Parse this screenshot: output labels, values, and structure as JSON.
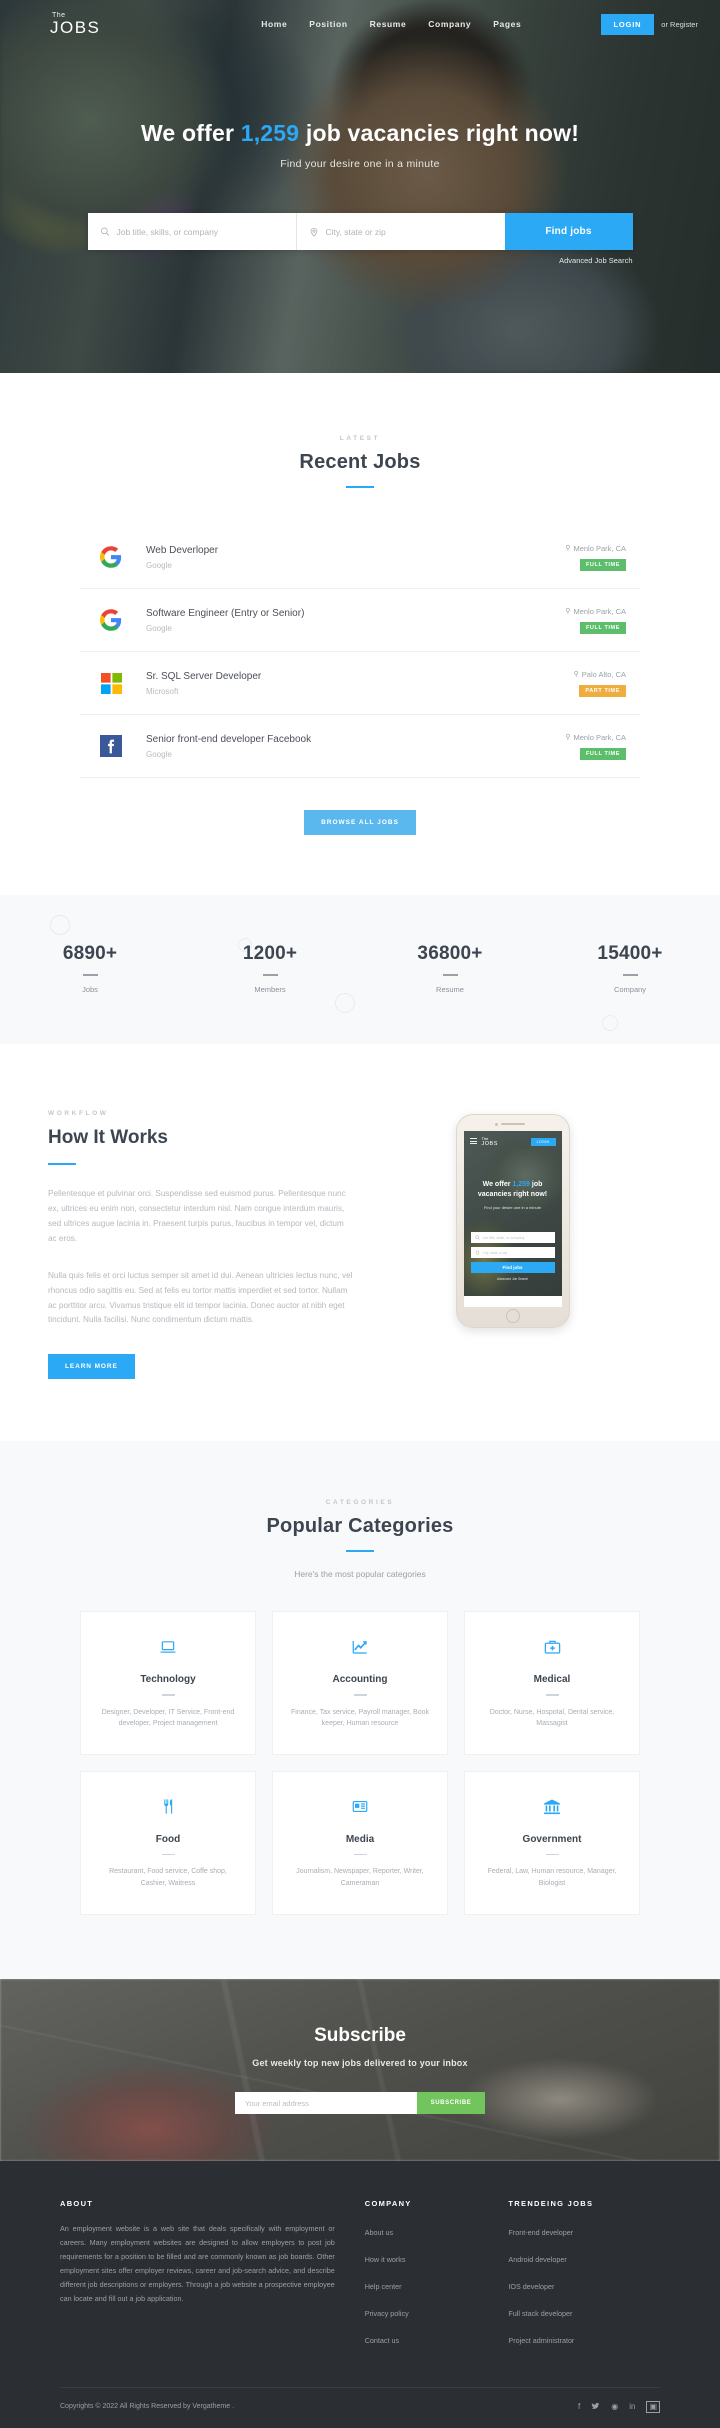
{
  "header": {
    "brand_the": "The",
    "brand_name": "JOBS",
    "nav": [
      {
        "label": "Home"
      },
      {
        "label": "Position"
      },
      {
        "label": "Resume"
      },
      {
        "label": "Company"
      },
      {
        "label": "Pages"
      }
    ],
    "login_label": "LOGIN",
    "or_register": "or Register"
  },
  "hero": {
    "title_pre": "We offer ",
    "title_count": "1,259",
    "title_post": " job vacancies right now!",
    "subtitle": "Find your desire one in a minute",
    "keyword_placeholder": "Job title, skills, or company",
    "location_placeholder": "City, state or zip",
    "keyword_value": "",
    "location_value": "",
    "find_jobs_label": "Find jobs",
    "advanced_search": "Advanced Job Search"
  },
  "recent": {
    "eyebrow": "LATEST",
    "title": "Recent Jobs",
    "jobs": [
      {
        "title": "Web Deverloper",
        "company": "Google",
        "logo": "google-logo",
        "location": "Menlo Park, CA",
        "type": "FULL TIME",
        "type_class": "full"
      },
      {
        "title": "Software Engineer (Entry or Senior)",
        "company": "Google",
        "logo": "google-logo",
        "location": "Menlo Park, CA",
        "type": "FULL TIME",
        "type_class": "full"
      },
      {
        "title": "Sr. SQL Server Developer",
        "company": "Microsoft",
        "logo": "microsoft-logo",
        "location": "Palo Alto, CA",
        "type": "PART TIME",
        "type_class": "part"
      },
      {
        "title": "Senior front-end developer Facebook",
        "company": "Google",
        "logo": "facebook-logo",
        "location": "Menlo Park, CA",
        "type": "FULL TIME",
        "type_class": "full"
      }
    ],
    "browse_label": "BROWSE ALL JOBS"
  },
  "counters": [
    {
      "value": "6890+",
      "label": "Jobs"
    },
    {
      "value": "1200+",
      "label": "Members"
    },
    {
      "value": "36800+",
      "label": "Resume"
    },
    {
      "value": "15400+",
      "label": "Company"
    }
  ],
  "howitworks": {
    "eyebrow": "WORKFLOW",
    "title": "How It Works",
    "paragraph1": "Pellentesque et pulvinar orci. Suspendisse sed euismod purus. Pellentesque nunc ex, ultrices eu enim non, consectetur interdum nisl. Nam congue interdum mauris, sed ultrices augue lacinia in. Praesent turpis purus, faucibus in tempor vel, dictum ac eros.",
    "paragraph2": "Nulla quis felis et orci luctus semper sit amet id dui. Aenean ultricies lectus nunc, vel rhoncus odio sagittis eu. Sed at felis eu tortor mattis imperdiet et sed tortor. Nullam ac porttitor arcu. Vivamus tristique elit id tempor lacinia. Donec auctor at nibh eget tincidunt. Nulla facilisi. Nunc condimentum dictum mattis.",
    "learn_more_label": "LEARN MORE",
    "phone": {
      "brand_the": "The",
      "brand_name": "JOBS",
      "login_label": "LOGIN",
      "title_pre": "We offer ",
      "title_count": "1,259",
      "title_post": " job vacancies right now!",
      "subtitle": "Find your desire one in a minute",
      "keyword_placeholder": "Job title, skills, or company",
      "location_placeholder": "City, state or zip",
      "find_jobs_label": "Find jobs",
      "advanced_search": "Advanced Job Search"
    }
  },
  "categories": {
    "eyebrow": "CATEGORIES",
    "title": "Popular Categories",
    "description": "Here's the most popular categories",
    "items": [
      {
        "name": "Technology",
        "icon": "laptop-icon",
        "desc": "Designer, Developer, IT Service, Front-end developer, Project management"
      },
      {
        "name": "Accounting",
        "icon": "chart-line-icon",
        "desc": "Finance, Tax service, Payroll manager, Book keeper, Human resource"
      },
      {
        "name": "Medical",
        "icon": "medical-kit-icon",
        "desc": "Doctor, Nurse, Hospotal, Dental service, Massagist"
      },
      {
        "name": "Food",
        "icon": "fork-knife-icon",
        "desc": "Restaurant, Food service, Coffe shop, Cashier, Waitress"
      },
      {
        "name": "Media",
        "icon": "newspaper-icon",
        "desc": "Journalism, Newspaper, Reporter, Writer, Cameraman"
      },
      {
        "name": "Government",
        "icon": "bank-icon",
        "desc": "Federal, Law, Human resource, Manager, Biologist"
      }
    ]
  },
  "subscribe": {
    "title": "Subscribe",
    "description": "Get weekly top new jobs delivered to your inbox",
    "email_placeholder": "Your email address",
    "email_value": "",
    "button_label": "SUBSCRIBE"
  },
  "footer": {
    "about_head": "ABOUT",
    "about_text": "An employment website is a web site that deals specifically with employment or careers. Many employment websites are designed to allow employers to post job requirements for a position to be filled and are commonly known as job boards. Other employment sites offer employer reviews, career and job-search advice, and describe different job descriptions or employers. Through a job website a prospective employee can locate and fill out a job application.",
    "company_head": "COMPANY",
    "company_links": [
      {
        "label": "About us"
      },
      {
        "label": "How it works"
      },
      {
        "label": "Help center"
      },
      {
        "label": "Privacy policy"
      },
      {
        "label": "Contact us"
      }
    ],
    "jobs_head": "TRENDEING JOBS",
    "jobs_links": [
      {
        "label": "Front-end developer"
      },
      {
        "label": "Android developer"
      },
      {
        "label": "IOS developer"
      },
      {
        "label": "Full stack developer"
      },
      {
        "label": "Project administrator"
      }
    ],
    "copyright": "Copyrights © 2022 All Rights Reserved by Vergatheme .",
    "socials": [
      {
        "name": "facebook-icon",
        "glyph": "f"
      },
      {
        "name": "twitter-icon",
        "glyph": "🐦"
      },
      {
        "name": "dribbble-icon",
        "glyph": "◉"
      },
      {
        "name": "linkedin-icon",
        "glyph": "in"
      },
      {
        "name": "rss-icon",
        "glyph": "▣"
      }
    ]
  },
  "colors": {
    "accent": "#2ca9f5",
    "full_time": "#5cbd6a",
    "part_time": "#f0ad3f",
    "subscribe": "#72c55c",
    "footer_bg": "#2b2e33"
  }
}
